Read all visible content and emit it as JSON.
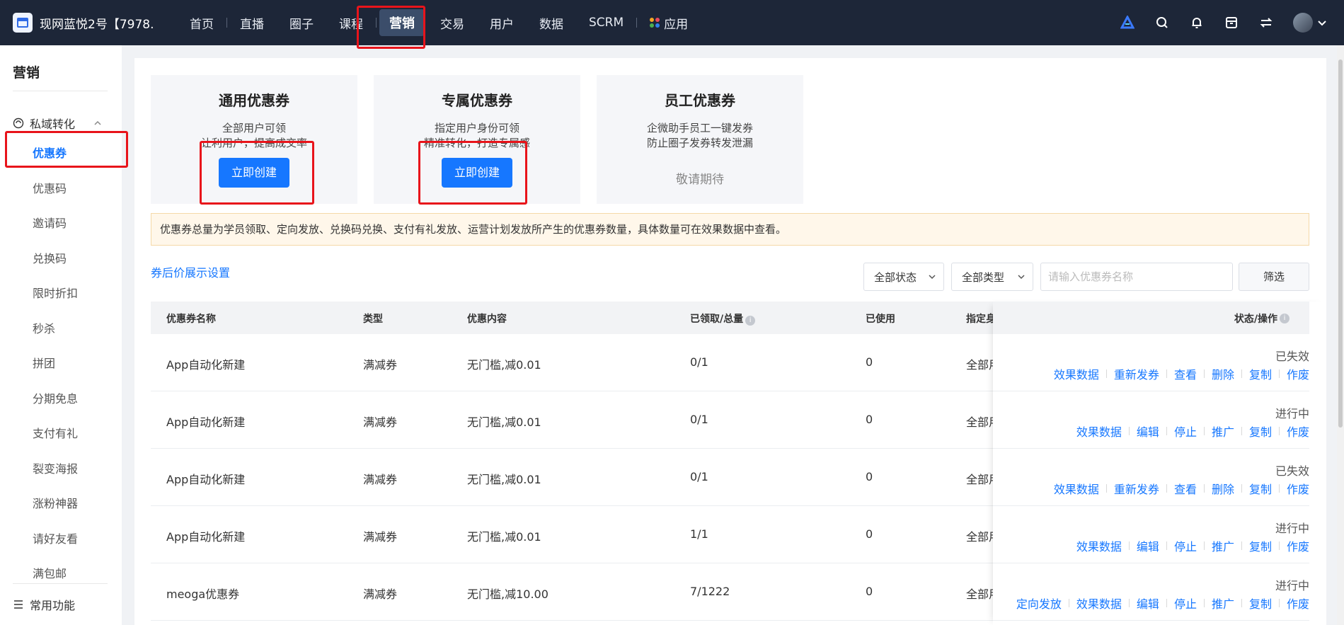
{
  "app": {
    "title": "现网蓝悦2号【7978..."
  },
  "nav": {
    "items": [
      "首页",
      "直播",
      "圈子",
      "课程",
      "营销",
      "交易",
      "用户",
      "数据",
      "SCRM",
      "应用"
    ],
    "active_index": 4
  },
  "sidebar": {
    "title": "营销",
    "group": "私域转化",
    "items": [
      "优惠券",
      "优惠码",
      "邀请码",
      "兑换码",
      "限时折扣",
      "秒杀",
      "拼团",
      "分期免息",
      "支付有礼",
      "裂变海报",
      "涨粉神器",
      "请好友看",
      "满包邮"
    ],
    "active_index": 0,
    "footer": "常用功能"
  },
  "cards": [
    {
      "title": "通用优惠券",
      "desc1": "全部用户可领",
      "desc2": "让利用户，提高成交率",
      "button": "立即创建"
    },
    {
      "title": "专属优惠券",
      "desc1": "指定用户身份可领",
      "desc2": "精准转化，打造专属感",
      "button": "立即创建"
    },
    {
      "title": "员工优惠券",
      "desc1": "企微助手员工一键发券",
      "desc2": "防止圈子发券转发泄漏",
      "wait": "敬请期待"
    }
  ],
  "notice": "优惠券总量为学员领取、定向发放、兑换码兑换、支付有礼发放、运营计划发放所产生的优惠券数量，具体数量可在效果数据中查看。",
  "toolbar": {
    "link": "券后价展示设置",
    "status_select": "全部状态",
    "type_select": "全部类型",
    "search_placeholder": "请输入优惠券名称",
    "filter_button": "筛选"
  },
  "table": {
    "headers": {
      "name": "优惠券名称",
      "type": "类型",
      "content": "优惠内容",
      "received": "已领取/总量",
      "used": "已使用",
      "target": "指定身",
      "action": "状态/操作"
    },
    "rows": [
      {
        "name": "App自动化新建",
        "type": "满减券",
        "content": "无门槛,减0.01",
        "received": "0/1",
        "used": "0",
        "target": "全部用",
        "status": "已失效",
        "ops": [
          "效果数据",
          "重新发券",
          "查看",
          "删除",
          "复制",
          "作废"
        ]
      },
      {
        "name": "App自动化新建",
        "type": "满减券",
        "content": "无门槛,减0.01",
        "received": "0/1",
        "used": "0",
        "target": "全部用",
        "status": "进行中",
        "ops": [
          "效果数据",
          "编辑",
          "停止",
          "推广",
          "复制",
          "作废"
        ]
      },
      {
        "name": "App自动化新建",
        "type": "满减券",
        "content": "无门槛,减0.01",
        "received": "0/1",
        "used": "0",
        "target": "全部用",
        "status": "已失效",
        "ops": [
          "效果数据",
          "重新发券",
          "查看",
          "删除",
          "复制",
          "作废"
        ]
      },
      {
        "name": "App自动化新建",
        "type": "满减券",
        "content": "无门槛,减0.01",
        "received": "1/1",
        "used": "0",
        "target": "全部用",
        "status": "进行中",
        "ops": [
          "效果数据",
          "编辑",
          "停止",
          "推广",
          "复制",
          "作废"
        ]
      },
      {
        "name": "meoga优惠券",
        "type": "满减券",
        "content": "无门槛,减10.00",
        "received": "7/1222",
        "used": "0",
        "target": "全部用",
        "status": "进行中",
        "ops": [
          "定向发放",
          "效果数据",
          "编辑",
          "停止",
          "推广",
          "复制",
          "作废"
        ]
      }
    ]
  },
  "colors": {
    "primary": "#1677ff",
    "topbar": "#1d2638",
    "highlight": "#e8141b"
  }
}
